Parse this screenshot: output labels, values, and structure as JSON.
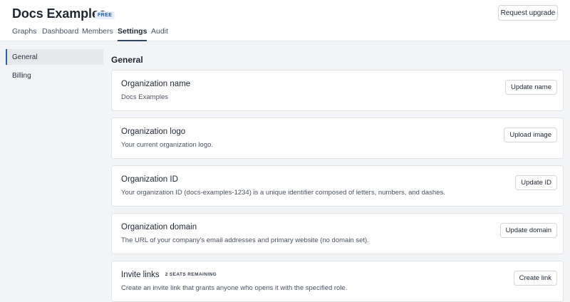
{
  "header": {
    "org_name": "Docs Examples",
    "plan_badge": "FREE",
    "upgrade_label": "Request upgrade",
    "tabs": [
      {
        "label": "Graphs"
      },
      {
        "label": "Dashboard"
      },
      {
        "label": "Members"
      },
      {
        "label": "Settings",
        "active": true
      },
      {
        "label": "Audit"
      }
    ]
  },
  "sidebar": {
    "items": [
      {
        "label": "General",
        "active": true
      },
      {
        "label": "Billing"
      }
    ]
  },
  "main": {
    "section_title": "General",
    "cards": [
      {
        "title": "Organization name",
        "description": "Docs Examples",
        "button": "Update name"
      },
      {
        "title": "Organization logo",
        "description": "Your current organization logo.",
        "button": "Upload image"
      },
      {
        "title": "Organization ID",
        "description": "Your organization ID (docs-examples-1234) is a unique identifier composed of letters, numbers, and dashes.",
        "button": "Update ID"
      },
      {
        "title": "Organization domain",
        "description": "The URL of your company's email addresses and primary website (no domain set).",
        "button": "Update domain"
      },
      {
        "title": "Invite links",
        "badge": "2 SEATS REMAINING",
        "description": "Create an invite link that grants anyone who opens it with the specified role.",
        "button": "Create link"
      }
    ]
  },
  "colors": {
    "accent": "#2f5db5",
    "badge_bg": "#e5eefb",
    "tab_underline": "#2f4560"
  }
}
